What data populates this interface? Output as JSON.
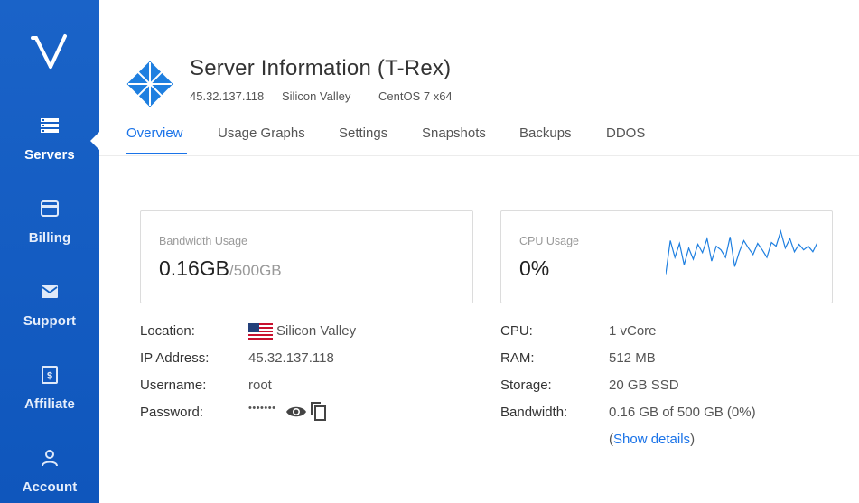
{
  "sidebar": {
    "items": [
      {
        "label": "Servers",
        "icon": "servers-icon",
        "active": true
      },
      {
        "label": "Billing",
        "icon": "credit-card-icon"
      },
      {
        "label": "Support",
        "icon": "mail-icon"
      },
      {
        "label": "Affiliate",
        "icon": "dollar-icon"
      },
      {
        "label": "Account",
        "icon": "user-icon"
      }
    ]
  },
  "header": {
    "title": "Server Information (T-Rex)",
    "ip": "45.32.137.118",
    "location": "Silicon Valley",
    "os": "CentOS 7 x64"
  },
  "tabs": [
    "Overview",
    "Usage Graphs",
    "Settings",
    "Snapshots",
    "Backups",
    "DDOS"
  ],
  "cards": {
    "bandwidth": {
      "label": "Bandwidth Usage",
      "value": "0.16GB",
      "total": "/500GB"
    },
    "cpu": {
      "label": "CPU Usage",
      "value": "0%",
      "sparkline": [
        12,
        48,
        30,
        45,
        22,
        40,
        28,
        44,
        35,
        50,
        26,
        42,
        38,
        30,
        52,
        20,
        36,
        48,
        40,
        33,
        45,
        38,
        30,
        46,
        42,
        58,
        40,
        50,
        36,
        44,
        38,
        42,
        36,
        46
      ]
    }
  },
  "details_left": {
    "location_label": "Location:",
    "location_value": "Silicon Valley",
    "ip_label": "IP Address:",
    "ip_value": "45.32.137.118",
    "username_label": "Username:",
    "username_value": "root",
    "password_label": "Password:",
    "password_value": "•••••••"
  },
  "details_right": {
    "cpu_label": "CPU:",
    "cpu_value": "1 vCore",
    "ram_label": "RAM:",
    "ram_value": "512 MB",
    "storage_label": "Storage:",
    "storage_value": "20 GB SSD",
    "bandwidth_label": "Bandwidth:",
    "bandwidth_value": "0.16 GB of 500 GB (0%)",
    "show_details_open": "(",
    "show_details_link": "Show details",
    "show_details_close": ")"
  },
  "colors": {
    "sidebar": "#1060c4",
    "accent": "#1a73e8",
    "logo_blue": "#1e7fe0"
  }
}
